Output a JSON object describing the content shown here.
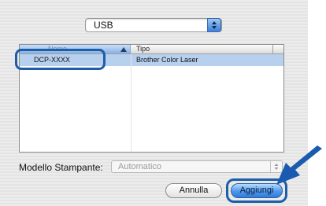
{
  "connection_popup": {
    "value": "USB"
  },
  "printer_table": {
    "columns": [
      "Nome",
      "Tipo"
    ],
    "rows": [
      {
        "name": "DCP-XXXX",
        "type": "Brother Color Laser"
      }
    ]
  },
  "model": {
    "label": "Modello Stampante:",
    "value": "Automatico"
  },
  "buttons": {
    "cancel": "Annulla",
    "add": "Aggiungi"
  },
  "colors": {
    "highlight": "#1d5ea8",
    "selection": "#b7d0ee"
  }
}
